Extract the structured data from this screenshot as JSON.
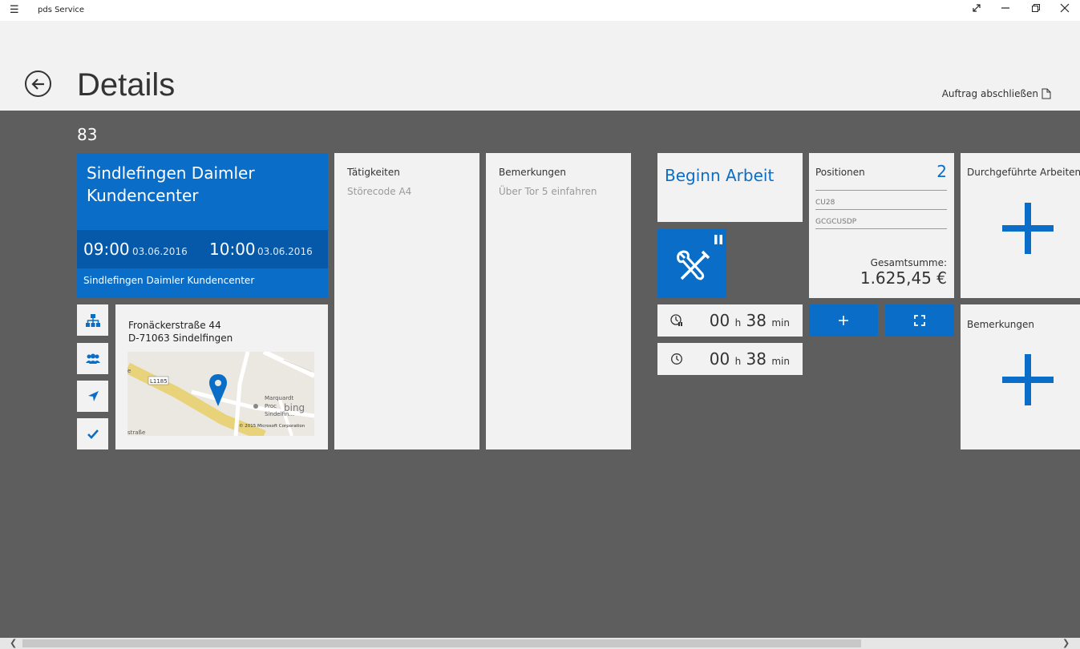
{
  "window": {
    "app_title": "pds Service",
    "menu_icon": "hamburger-icon",
    "controls": [
      "expand-icon",
      "minimize-icon",
      "restore-icon",
      "close-icon"
    ]
  },
  "header": {
    "title": "Details",
    "close_order_label": "Auftrag abschließen"
  },
  "order": {
    "number": "83",
    "customer_name": "Sindlefingen Daimler Kundencenter",
    "start_time": "09:00",
    "start_date": "03.06.2016",
    "end_time": "10:00",
    "end_date": "03.06.2016",
    "location": "Sindlefingen Daimler Kundencenter"
  },
  "address": {
    "street": "Fronäckerstraße 44",
    "city": "D-71063 Sindelfingen",
    "map": {
      "road_label": "L1185",
      "poi_label_1": "Marquardt",
      "poi_label_2": "Proc",
      "poi_label_3": "Sindelfin...",
      "street_label": "straße",
      "edge_label": "e",
      "brand": "bing",
      "copyright": "© 2015 Microsoft Corporation"
    }
  },
  "side_buttons": [
    "hierarchy-icon",
    "group-icon",
    "navigate-icon",
    "checkmark-icon"
  ],
  "taetigkeiten": {
    "label": "Tätigkeiten",
    "value": "Störecode A4"
  },
  "bemerkungen_note": {
    "label": "Bemerkungen",
    "value": "Über Tor 5 einfahren"
  },
  "work": {
    "begin_label": "Beginn Arbeit",
    "timer1": {
      "hours": "00",
      "h": "h",
      "minutes": "38",
      "min": "min"
    },
    "timer2": {
      "hours": "00",
      "h": "h",
      "minutes": "38",
      "min": "min"
    }
  },
  "positionen": {
    "label": "Positionen",
    "count": "2",
    "items": [
      "CU28",
      "GCGCUSDP"
    ],
    "total_label": "Gesamtsumme:",
    "total_value": "1.625,45 €"
  },
  "durchgefuehrte": {
    "label": "Durchgeführte Arbeiten"
  },
  "bemerkungen": {
    "label": "Bemerkungen"
  },
  "colors": {
    "accent": "#0a6ec8",
    "accent_dark": "#0658a8",
    "background": "#5e5e5e",
    "tile": "#f2f2f2"
  }
}
